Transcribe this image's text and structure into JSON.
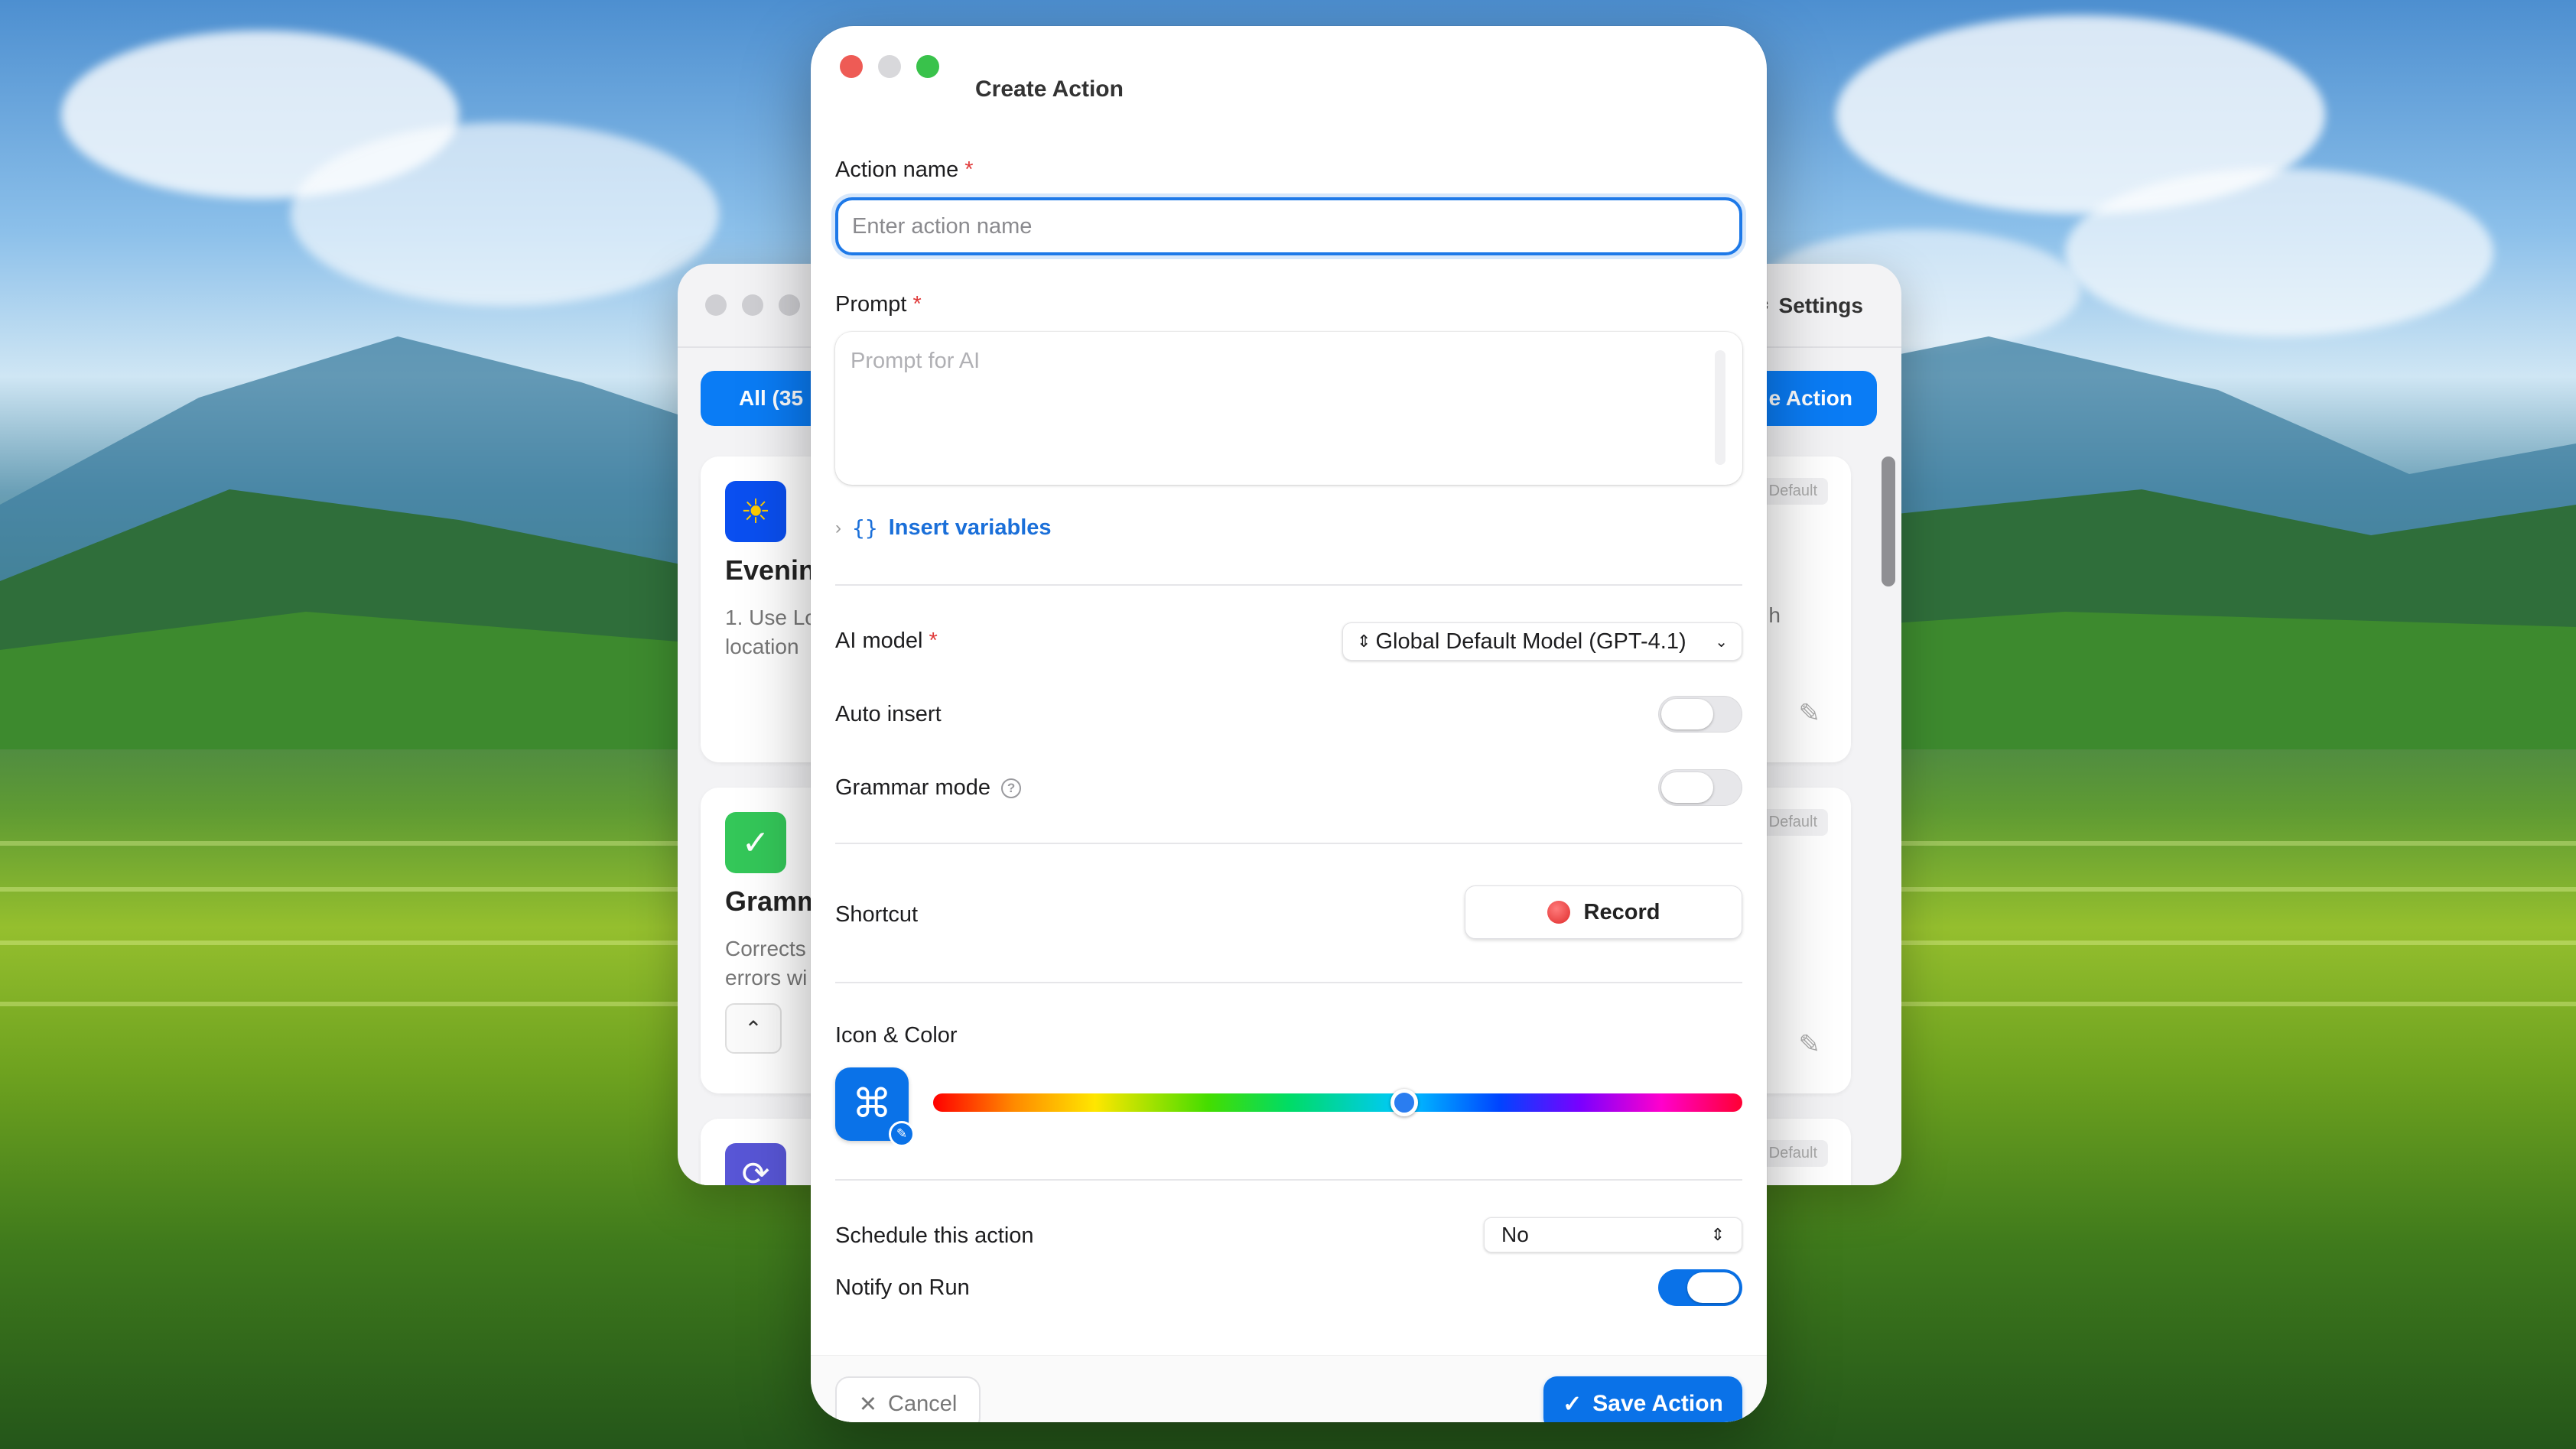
{
  "background_window": {
    "settings_label": "Settings",
    "filter_all_label": "All (35",
    "create_action_label": "e Action",
    "cards": [
      {
        "icon": "sun-icon",
        "icon_glyph": "☀",
        "icon_color": "#0a4ff0",
        "title": "Evenin",
        "description_1": "1. Use Lo",
        "description_2": "location",
        "right_text": "h",
        "badge": "Default"
      },
      {
        "icon": "chat-check-icon",
        "icon_glyph": "✓",
        "icon_color": "#34c759",
        "title": "Gramm",
        "description_1": "Corrects",
        "description_2": "errors wi",
        "badge": "Default"
      },
      {
        "icon": "refresh-icon",
        "icon_glyph": "⟳",
        "icon_color": "#5856d6",
        "badge": "Default"
      }
    ]
  },
  "modal": {
    "title": "Create Action",
    "action_name": {
      "label": "Action name",
      "required_mark": "*",
      "placeholder": "Enter action name",
      "value": ""
    },
    "prompt": {
      "label": "Prompt",
      "required_mark": "*",
      "placeholder": "Prompt for AI",
      "value": ""
    },
    "insert_variables": {
      "chevron": "›",
      "braces": "{}",
      "label": "Insert variables"
    },
    "ai_model": {
      "label": "AI model",
      "required_mark": "*",
      "selected": "Global Default Model (GPT-4.1)"
    },
    "auto_insert": {
      "label": "Auto insert",
      "on": false
    },
    "grammar_mode": {
      "label": "Grammar mode",
      "help_glyph": "?",
      "on": false
    },
    "shortcut": {
      "label": "Shortcut",
      "record_label": "Record"
    },
    "icon_color": {
      "label": "Icon & Color",
      "icon": "command-icon",
      "icon_glyph": "⌘",
      "color": "#0a72e8",
      "hue_fraction": 0.585
    },
    "schedule": {
      "label": "Schedule this action",
      "selected": "No"
    },
    "notify_on_run": {
      "label": "Notify on Run",
      "on": true
    },
    "footer": {
      "cancel_label": "Cancel",
      "save_label": "Save Action"
    }
  }
}
